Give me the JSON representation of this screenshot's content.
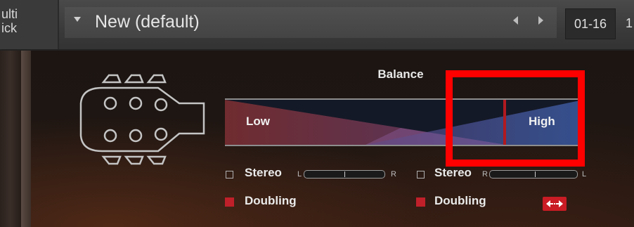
{
  "header": {
    "left_label": "ulti\nick",
    "preset_name": "New (default)",
    "channel_range": "01-16",
    "range_suffix": "1"
  },
  "balance": {
    "title": "Balance",
    "low_label": "Low",
    "high_label": "High",
    "value_fraction": 0.78
  },
  "left_channel": {
    "stereo_label": "Stereo",
    "stereo_checked": false,
    "pan_left": "L",
    "pan_right": "R",
    "doubling_label": "Doubling",
    "doubling_checked": true
  },
  "right_channel": {
    "stereo_label": "Stereo",
    "stereo_checked": false,
    "pan_left": "R",
    "pan_right": "L",
    "doubling_label": "Doubling",
    "doubling_checked": true
  },
  "icons": {
    "preset_menu": "chevron-down-icon",
    "prev": "arrow-left-icon",
    "next": "arrow-right-icon",
    "headstock": "guitar-headstock-icon",
    "swap": "swap-arrows-icon"
  },
  "colors": {
    "accent_red": "#c91c24",
    "highlight_red": "#ff0000",
    "low_fill": "#7a3a40",
    "high_fill": "#3a4a80"
  }
}
